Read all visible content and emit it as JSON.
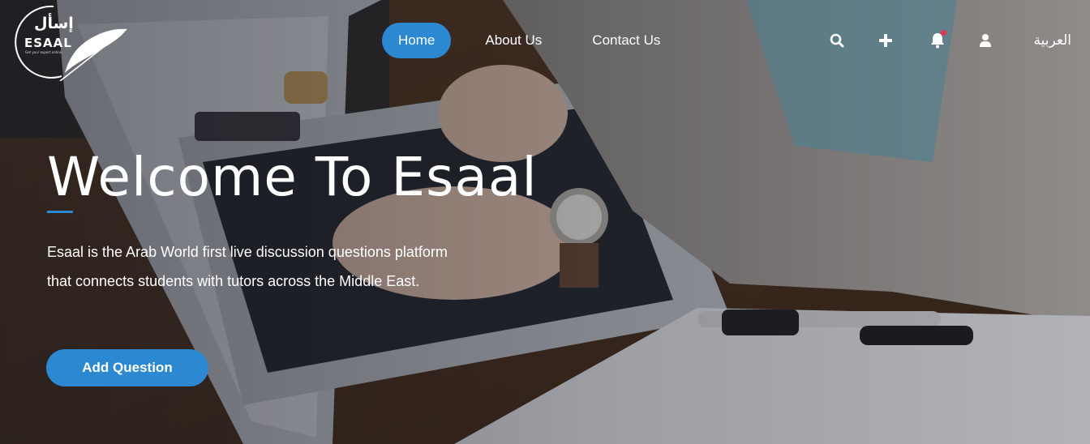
{
  "logo": {
    "arabic_text": "إسأل",
    "english_text": "ESAAL",
    "tagline": "Get your expert online"
  },
  "nav": {
    "items": [
      {
        "label": "Home",
        "active": true
      },
      {
        "label": "About Us",
        "active": false
      },
      {
        "label": "Contact Us",
        "active": false
      }
    ]
  },
  "header_actions": {
    "icons": [
      "search-icon",
      "plus-icon",
      "bell-icon",
      "user-icon"
    ],
    "notification_indicator": true,
    "language_label": "العربية"
  },
  "hero": {
    "title": "Welcome To Esaal",
    "description": "Esaal is the Arab World first live discussion questions platform that connects students with tutors across the Middle East.",
    "cta_label": "Add Question"
  },
  "colors": {
    "accent": "#2d88d2",
    "notification": "#e8344a",
    "text": "#ffffff"
  }
}
